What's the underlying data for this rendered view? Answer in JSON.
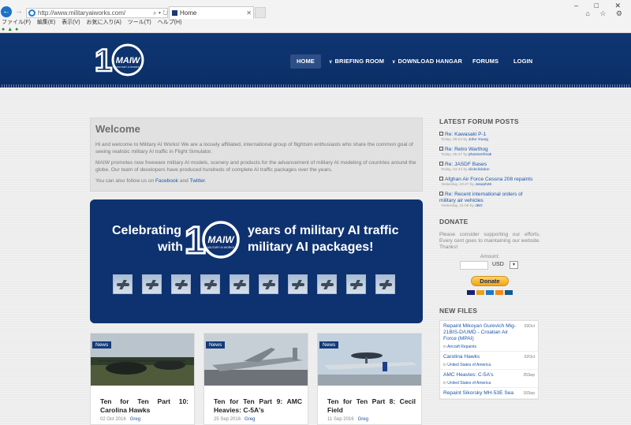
{
  "browser": {
    "address_url": "http://www.militaryaiworks.com/",
    "address_tools": "⌕ ▾ ↻ ✕",
    "tab_title": "Home",
    "tab_close": "✕",
    "window_controls": "– □ ✕",
    "toolbar_icons": "⌂ ☆ ⚙",
    "back": "←",
    "forward": "→",
    "menu": [
      "ファイル(F)",
      "編集(E)",
      "表示(V)",
      "お気に入り(A)",
      "ツール(T)",
      "ヘルプ(H)"
    ]
  },
  "logo_text": {
    "main": "MAIW",
    "sub": "MILITARY AI WORKS",
    "number": "10"
  },
  "nav": [
    {
      "label": "HOME",
      "dropdown": false
    },
    {
      "label": "BRIEFING ROOM",
      "dropdown": true
    },
    {
      "label": "DOWNLOAD HANGAR",
      "dropdown": true
    },
    {
      "label": "FORUMS",
      "dropdown": false
    },
    {
      "label": "LOGIN",
      "dropdown": false
    }
  ],
  "welcome": {
    "title": "Welcome",
    "p1": "Hi and welcome to Military AI Works! We are a loosely affiliated, international group of flightsim enthusiasts who share the common goal of seeing realistic military AI traffic in Flight Simulator.",
    "p2": "MAIW promotes now freeware military AI models, scenery and products for the advancement of military AI modeling of countries around the globe. Our team of developers have produced hundreds of complete AI traffic packages over the years.",
    "p3_prefix": "You can also follow us on ",
    "facebook": "Facebook",
    "p3_and": " and ",
    "twitter": "Twitter",
    "p3_suffix": "."
  },
  "banner": {
    "line1_left": "Celebrating",
    "line2_left": "with",
    "line1_right": "years of military AI  traffic",
    "line2_right": "military AI packages!"
  },
  "news": [
    {
      "badge": "News",
      "title": "Ten for Ten Part 10: Carolina Hawks",
      "date": "02 Oct 2016",
      "author": "Greg"
    },
    {
      "badge": "News",
      "title": "Ten for Ten Part 9: AMC Heavies: C-5A's",
      "date": "25 Sep 2016",
      "author": "Greg"
    },
    {
      "badge": "News",
      "title": "Ten for Ten Part 8: Cecil Field",
      "date": "11 Sep 2016",
      "author": "Greg"
    }
  ],
  "sidebar": {
    "forum_heading": "LATEST FORUM POSTS",
    "posts": [
      {
        "title": "Re: Kawasaki P-1",
        "meta": "Today, 09:24 by",
        "author": "John Young"
      },
      {
        "title": "Re: Retro Warthog",
        "meta": "Today, 05:47 by",
        "author": "phantomfreak"
      },
      {
        "title": "Re: JASDF Bases",
        "meta": "Today, 04:42 by",
        "author": "clickclickdon"
      },
      {
        "title": "Afghan Air Force Cessna 208 repaints",
        "meta": "Yesterday, 23:47 by",
        "author": "Joseph28"
      },
      {
        "title": "Re: Recent international orders of military air vehicles",
        "meta": "Yesterday, 21:09 by",
        "author": "JBO"
      }
    ],
    "donate_heading": "DONATE",
    "donate_text": "Please consider supporting our efforts. Every cent goes to maintaining our website. Thanks!",
    "amount_label": "Amount:",
    "currency": "USD",
    "currency_arrow": "▾",
    "donate_button": "Donate",
    "newfiles_heading": "NEW FILES",
    "files": [
      {
        "title": "Repaint Mikoyan Gurevich Mig-21BIS-D/UMD - Croatian Air Force (MPAI)",
        "date": "03Oct",
        "cat_prefix": "in",
        "category": "Aircraft Repaints"
      },
      {
        "title": "Carolina Hawks",
        "date": "02Oct",
        "cat_prefix": "in",
        "category": "United States of America"
      },
      {
        "title": "AMC Heavies: C-5A's",
        "date": "25Sep",
        "cat_prefix": "in",
        "category": "United States of America"
      },
      {
        "title": "Repaint Sikorsky MH-53E Sea",
        "date": "16Sep",
        "cat_prefix": "",
        "category": ""
      }
    ]
  },
  "colors": {
    "navy": "#0e3470",
    "link": "#1b56a8",
    "donate": "#f3a40e"
  }
}
